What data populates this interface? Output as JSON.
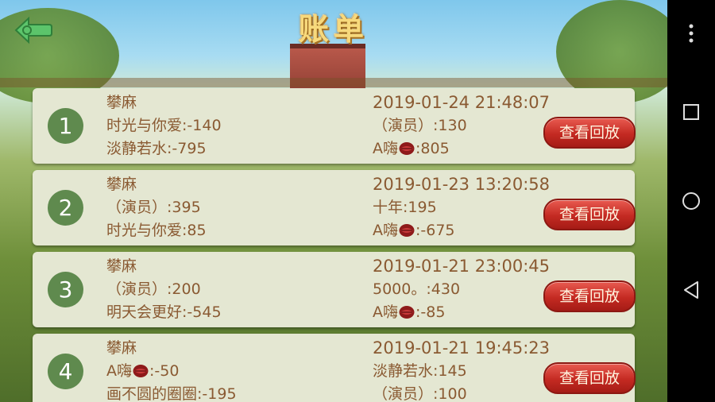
{
  "header": {
    "title": "账单"
  },
  "replay_label": "查看回放",
  "records": [
    {
      "index": "1",
      "game": "攀麻",
      "datetime": "2019-01-24 21:48:07",
      "left": [
        {
          "name": "时光与你爱",
          "score": ":-140"
        },
        {
          "name": "淡静若水",
          "score": ":-795"
        }
      ],
      "right": [
        {
          "name": "（演员）",
          "score": ":130",
          "lips": false
        },
        {
          "name": "A嗨",
          "score": ":805",
          "lips": true
        }
      ]
    },
    {
      "index": "2",
      "game": "攀麻",
      "datetime": "2019-01-23 13:20:58",
      "left": [
        {
          "name": "（演员）",
          "score": ":395"
        },
        {
          "name": "时光与你爱",
          "score": ":85"
        }
      ],
      "right": [
        {
          "name": "十年",
          "score": ":195",
          "lips": false
        },
        {
          "name": "A嗨",
          "score": ":-675",
          "lips": true
        }
      ]
    },
    {
      "index": "3",
      "game": "攀麻",
      "datetime": "2019-01-21 23:00:45",
      "left": [
        {
          "name": "（演员）",
          "score": ":200"
        },
        {
          "name": "明天会更好",
          "score": ":-545"
        }
      ],
      "right": [
        {
          "name": "5000。",
          "score": ":430",
          "lips": false
        },
        {
          "name": "A嗨",
          "score": ":-85",
          "lips": true
        }
      ]
    },
    {
      "index": "4",
      "game": "攀麻",
      "datetime": "2019-01-21 19:45:23",
      "left": [
        {
          "name": "A嗨",
          "score": ":-50",
          "lips": true
        },
        {
          "name": "画不圆的圈圈",
          "score": ":-195"
        }
      ],
      "right": [
        {
          "name": "淡静若水",
          "score": ":145",
          "lips": false
        },
        {
          "name": "（演员）",
          "score": ":100",
          "lips": false
        }
      ]
    }
  ],
  "colors": {
    "card": "#e4e7d2",
    "text": "#8a5a32",
    "badge": "#5f8a4e",
    "button": "#c42a22"
  },
  "icons": {
    "back": "back-arrow-icon",
    "lips": "lips-icon",
    "menu": "more-vert-icon",
    "recents": "recents-icon",
    "home": "home-icon",
    "back_nav": "nav-back-icon"
  }
}
